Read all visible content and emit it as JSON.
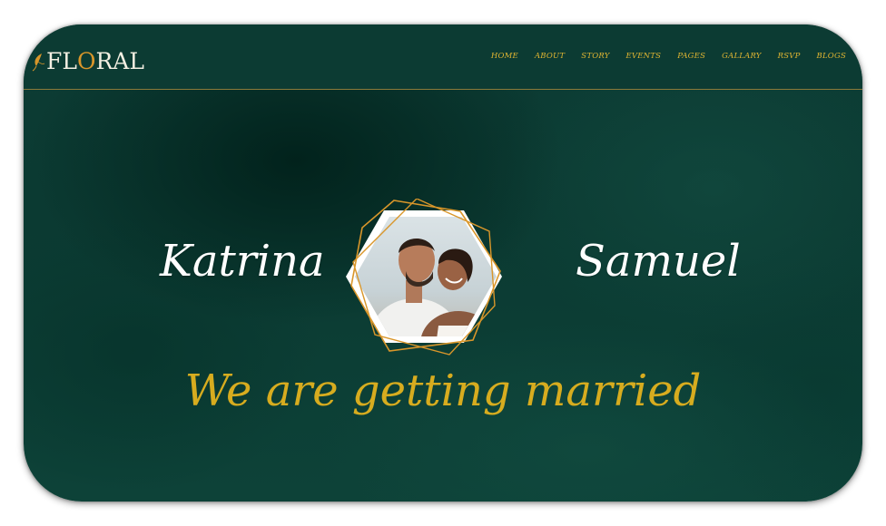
{
  "brand": {
    "logo_text_pre": "FL",
    "logo_text_accent": "O",
    "logo_text_post": "RAL"
  },
  "nav": {
    "items": [
      "HOME",
      "ABOUT",
      "STORY",
      "EVENTS",
      "PAGES",
      "GALLARY",
      "RSVP",
      "BLOGS"
    ]
  },
  "hero": {
    "bride_name": "Katrina",
    "groom_name": "Samuel",
    "tagline": "We are getting married"
  },
  "colors": {
    "background": "#0c3b33",
    "gold": "#d7ac1f",
    "orange_accent": "#d9962a",
    "white": "#ffffff"
  },
  "icons": {
    "logo": "leaf-icon"
  }
}
